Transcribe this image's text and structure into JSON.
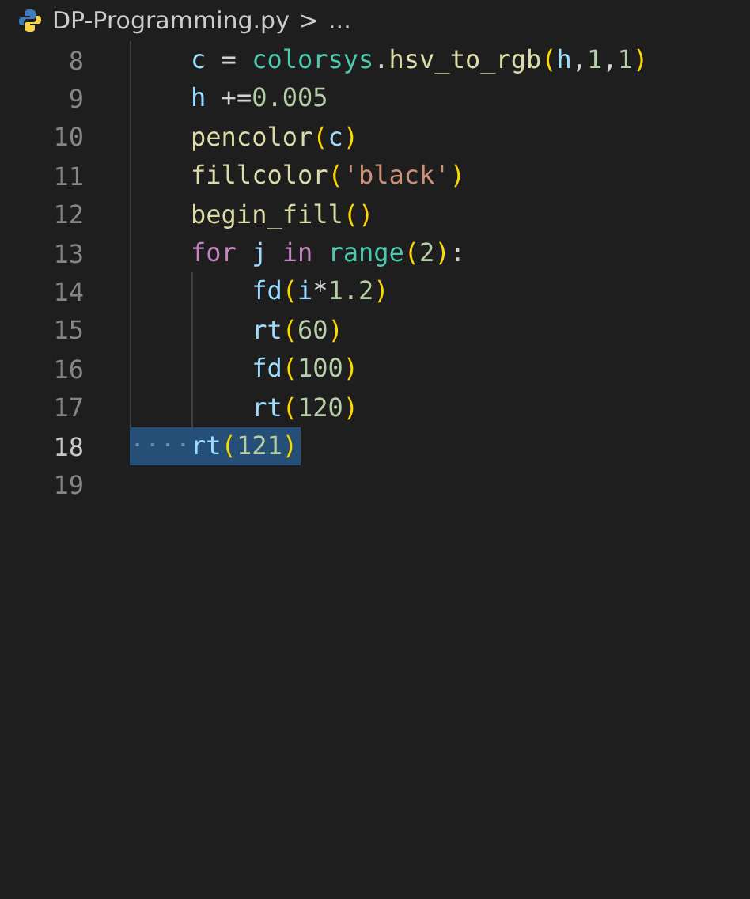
{
  "breadcrumb": {
    "file": "DP-Programming.py",
    "separator": ">",
    "more": "..."
  },
  "lines": [
    {
      "number": "8",
      "selected": false,
      "tokens": [
        {
          "kind": "variable",
          "text": "    c"
        },
        {
          "kind": "plain",
          "text": " = "
        },
        {
          "kind": "module",
          "text": "colorsys"
        },
        {
          "kind": "plain",
          "text": "."
        },
        {
          "kind": "function",
          "text": "hsv_to_rgb"
        },
        {
          "kind": "bracket",
          "text": "("
        },
        {
          "kind": "variable",
          "text": "h"
        },
        {
          "kind": "plain",
          "text": ","
        },
        {
          "kind": "number",
          "text": "1"
        },
        {
          "kind": "plain",
          "text": ","
        },
        {
          "kind": "number",
          "text": "1"
        },
        {
          "kind": "bracket",
          "text": ")"
        }
      ]
    },
    {
      "number": "9",
      "selected": false,
      "tokens": [
        {
          "kind": "variable",
          "text": "    h"
        },
        {
          "kind": "plain",
          "text": " +="
        },
        {
          "kind": "number",
          "text": "0.005"
        }
      ]
    },
    {
      "number": "10",
      "selected": false,
      "tokens": [
        {
          "kind": "function",
          "text": "    pencolor"
        },
        {
          "kind": "bracket",
          "text": "("
        },
        {
          "kind": "variable",
          "text": "c"
        },
        {
          "kind": "bracket",
          "text": ")"
        }
      ]
    },
    {
      "number": "11",
      "selected": false,
      "tokens": [
        {
          "kind": "function",
          "text": "    fillcolor"
        },
        {
          "kind": "bracket",
          "text": "("
        },
        {
          "kind": "string",
          "text": "'black'"
        },
        {
          "kind": "bracket",
          "text": ")"
        }
      ]
    },
    {
      "number": "12",
      "selected": false,
      "tokens": [
        {
          "kind": "function",
          "text": "    begin_fill"
        },
        {
          "kind": "bracket",
          "text": "()"
        }
      ]
    },
    {
      "number": "13",
      "selected": false,
      "tokens": [
        {
          "kind": "keyword",
          "text": "    for"
        },
        {
          "kind": "variable",
          "text": " j"
        },
        {
          "kind": "keyword",
          "text": " in"
        },
        {
          "kind": "module",
          "text": " range"
        },
        {
          "kind": "bracket",
          "text": "("
        },
        {
          "kind": "number",
          "text": "2"
        },
        {
          "kind": "bracket",
          "text": ")"
        },
        {
          "kind": "plain",
          "text": ":"
        }
      ]
    },
    {
      "number": "14",
      "selected": false,
      "tokens": [
        {
          "kind": "call",
          "text": "        fd"
        },
        {
          "kind": "bracket",
          "text": "("
        },
        {
          "kind": "variable",
          "text": "i"
        },
        {
          "kind": "plain",
          "text": "*"
        },
        {
          "kind": "number",
          "text": "1.2"
        },
        {
          "kind": "bracket",
          "text": ")"
        }
      ]
    },
    {
      "number": "15",
      "selected": false,
      "tokens": [
        {
          "kind": "call",
          "text": "        rt"
        },
        {
          "kind": "bracket",
          "text": "("
        },
        {
          "kind": "number",
          "text": "60"
        },
        {
          "kind": "bracket",
          "text": ")"
        }
      ]
    },
    {
      "number": "16",
      "selected": false,
      "tokens": [
        {
          "kind": "call",
          "text": "        fd"
        },
        {
          "kind": "bracket",
          "text": "("
        },
        {
          "kind": "number",
          "text": "100"
        },
        {
          "kind": "bracket",
          "text": ")"
        }
      ]
    },
    {
      "number": "17",
      "selected": false,
      "tokens": [
        {
          "kind": "call",
          "text": "        rt"
        },
        {
          "kind": "bracket",
          "text": "("
        },
        {
          "kind": "number",
          "text": "120"
        },
        {
          "kind": "bracket",
          "text": ")"
        }
      ]
    },
    {
      "number": "18",
      "selected": true,
      "tokens": [
        {
          "kind": "call",
          "text": "    rt"
        },
        {
          "kind": "bracket",
          "text": "("
        },
        {
          "kind": "number",
          "text": "121"
        },
        {
          "kind": "bracket",
          "text": ")"
        }
      ]
    },
    {
      "number": "19",
      "selected": false
    }
  ]
}
